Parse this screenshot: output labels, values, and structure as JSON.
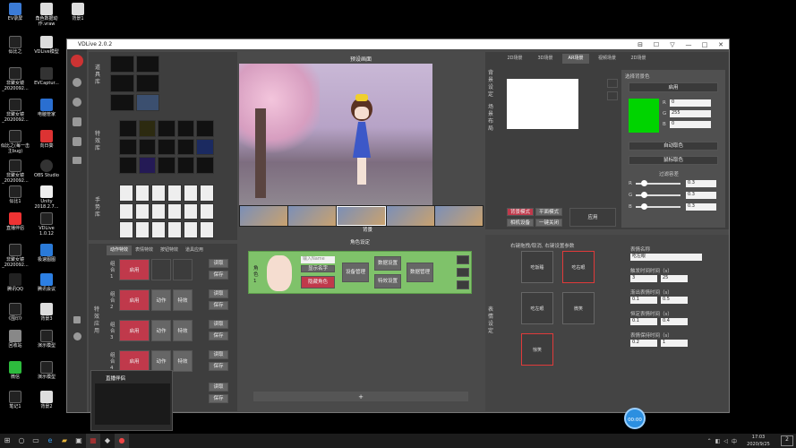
{
  "desktop": {
    "icons": [
      {
        "label": "EV录屏"
      },
      {
        "label": "角色数据动作.vraw"
      },
      {
        "label": "背景1"
      },
      {
        "label": "似比之"
      },
      {
        "label": "VDLive模型"
      },
      {
        "label": "非聚女镜_2020092..."
      },
      {
        "label": "EVCaptur..."
      },
      {
        "label": "非聚女镜_2020092..."
      },
      {
        "label": "电脑管家"
      },
      {
        "label": "似比之(每一击主bug)"
      },
      {
        "label": "向日葵"
      },
      {
        "label": "非聚女镜_2020092..."
      },
      {
        "label": "OBS Studio"
      },
      {
        "label": "似比1"
      },
      {
        "label": "Unity 2018.2.7..."
      },
      {
        "label": "直播伴侣"
      },
      {
        "label": "VDLive 1.0.12"
      },
      {
        "label": "非聚女镜_2020092..."
      },
      {
        "label": "极速图图"
      },
      {
        "label": "腾讯QQ"
      },
      {
        "label": "腾讯会议"
      },
      {
        "label": "《围印》"
      },
      {
        "label": "背景3"
      },
      {
        "label": "回收站"
      },
      {
        "label": "演示模型"
      },
      {
        "label": "微信"
      },
      {
        "label": "演示模型"
      },
      {
        "label": "笔记1"
      },
      {
        "label": "背景2"
      }
    ]
  },
  "window": {
    "title": "VDLive 2.0.2",
    "controls": [
      "⊟",
      "☐",
      "▽",
      "—",
      "□",
      "✕"
    ]
  },
  "left": {
    "prop_lib": "道具库",
    "effect_lib": "特效库",
    "gesture_lib": "手势库",
    "tabs": [
      "动作特效",
      "表情特效",
      "按钮特效",
      "道具应用"
    ],
    "effect_app": "特效应用",
    "combos": [
      {
        "label": "组合1",
        "enable": "启用",
        "read": "读取",
        "save": "保存"
      },
      {
        "label": "组合2",
        "enable": "启用",
        "read": "读取",
        "save": "保存",
        "a": "动作",
        "b": "特效"
      },
      {
        "label": "组合3",
        "enable": "启用",
        "read": "读取",
        "save": "保存",
        "a": "动作",
        "b": "特效"
      },
      {
        "label": "组合4",
        "enable": "启用",
        "read": "读取",
        "save": "保存",
        "a": "动作",
        "b": "特效"
      },
      {
        "label": "组合5",
        "read": "读取",
        "save": "保存"
      }
    ]
  },
  "center": {
    "preview_title": "预设画面",
    "strip_label": "背景",
    "role_title": "角色设定",
    "role_label": "角色1",
    "name_placeholder": "输入Name",
    "show_name": "显示名字",
    "hide_role": "隐藏角色",
    "device_mgmt": "设备管理",
    "data_settings": "数据设置",
    "effect_settings": "特效设置",
    "data_mgmt": "数据管理",
    "add": "+"
  },
  "right": {
    "vtabs": [
      "背景设定",
      "场景布局"
    ],
    "tabs": [
      "2D场景",
      "3D场景",
      "AR场景",
      "视频场景",
      "2D场景"
    ],
    "key_color_title": "选择背景色",
    "enable": "启用",
    "rgb": [
      {
        "ch": "R",
        "v": "0"
      },
      {
        "ch": "G",
        "v": "255"
      },
      {
        "ch": "B",
        "v": "0"
      }
    ],
    "auto_pick": "自动取色",
    "mouse_pick": "鼠标取色",
    "filter_title": "过滤容差",
    "filters": [
      {
        "ch": "R",
        "v": "0.3"
      },
      {
        "ch": "G",
        "v": "0.3"
      },
      {
        "ch": "B",
        "v": "0.3"
      }
    ],
    "bg_mode": "背景模式",
    "plane_mode": "平面模式",
    "camera_settings": "相机设备",
    "one_key_off": "一键关闭",
    "apply": "应用",
    "key_color": "#00d400"
  },
  "expr": {
    "vlabel": "表情设定",
    "hint": "右键拖拽/取消, 右键设置参数",
    "boxes": [
      "吃饭睡",
      "吃右眼",
      "吃左眼",
      "微笑",
      "惊笑"
    ],
    "name_label": "表情名称",
    "name_val": "吃左眼",
    "trigger_label": "触发时间时间（s）",
    "trigger_a": "3",
    "trigger_b": "25",
    "fadein_label": "渐出表情时间（s）",
    "fadein_a": "0.1",
    "fadein_b": "0.5",
    "keep_label": "恒定表情时间（s）",
    "keep_a": "0.1",
    "keep_b": "0.4",
    "fadeout_label": "表情保持时间（s）",
    "fadeout_a": "0.2",
    "fadeout_b": "1"
  },
  "mini": {
    "title": "直播伴侣"
  },
  "rec": {
    "label": "00:00"
  },
  "clock": {
    "time": "17:03",
    "date": "2020/9/25"
  },
  "tray": {
    "ime": "中",
    "notify": "2"
  }
}
